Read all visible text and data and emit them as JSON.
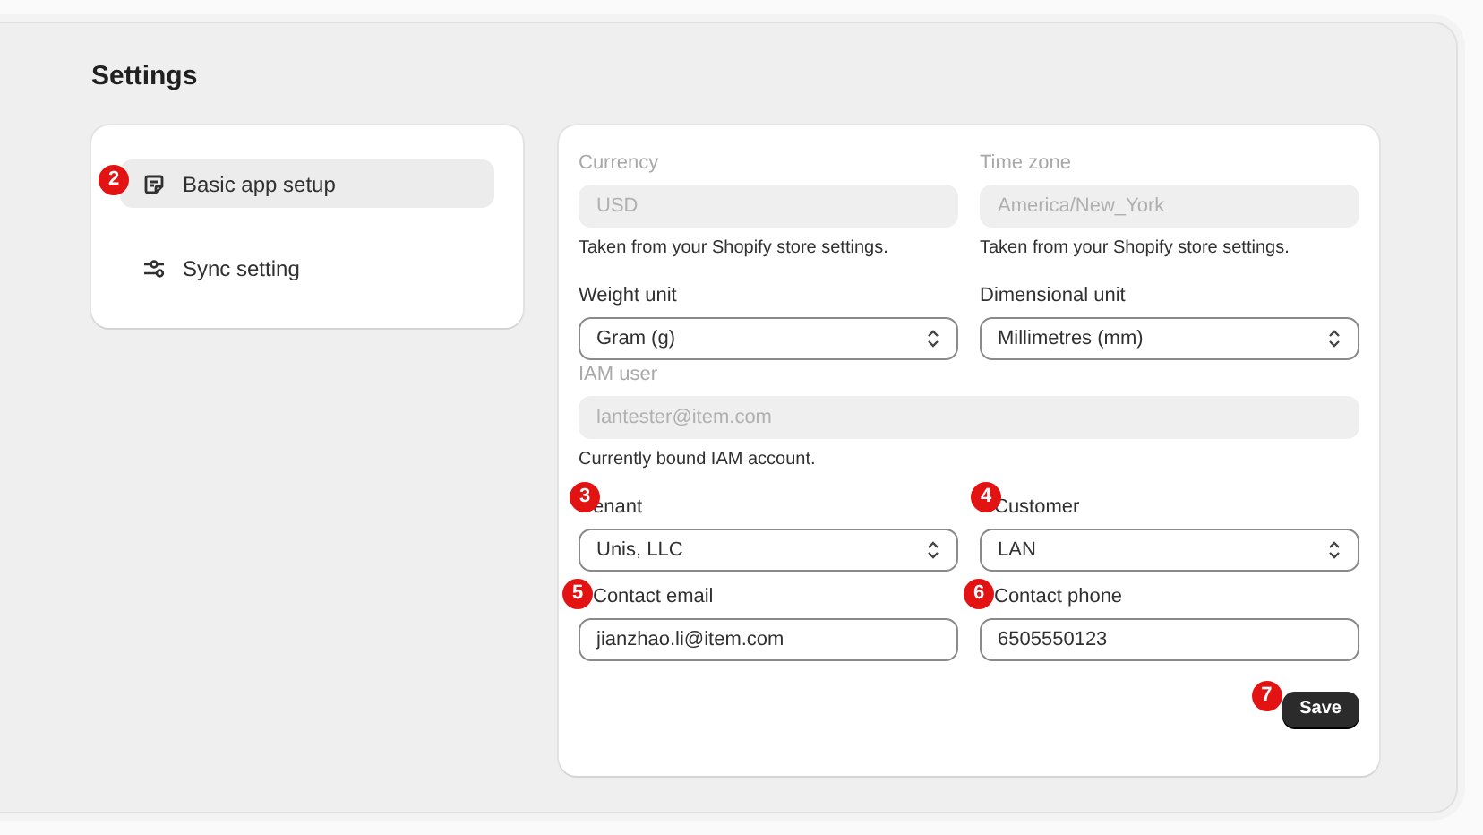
{
  "title": "Settings",
  "sidebar": {
    "items": [
      {
        "label": "Basic app setup",
        "selected": true,
        "badge": "2"
      },
      {
        "label": "Sync setting",
        "selected": false
      }
    ]
  },
  "form": {
    "rows": [
      {
        "fields": [
          {
            "kind": "text",
            "label": "Currency",
            "value": "USD",
            "disabled": true,
            "help": "Taken from your Shopify store settings."
          },
          {
            "kind": "text",
            "label": "Time zone",
            "value": "America/New_York",
            "disabled": true,
            "help": "Taken from your Shopify store settings."
          }
        ]
      },
      {
        "fields": [
          {
            "kind": "select",
            "label": "Weight unit",
            "value": "Gram (g)",
            "disabled": false
          },
          {
            "kind": "select",
            "label": "Dimensional unit",
            "value": "Millimetres (mm)",
            "disabled": false
          }
        ]
      },
      {
        "fields": [
          {
            "kind": "text",
            "label": "IAM user",
            "value": "lantester@item.com",
            "disabled": true,
            "help": "Currently bound IAM account."
          }
        ]
      },
      {
        "fields": [
          {
            "kind": "select",
            "label": "enant",
            "value": "Unis, LLC",
            "disabled": false,
            "badge": "3"
          },
          {
            "kind": "select",
            "label": "Customer",
            "value": "LAN",
            "disabled": false,
            "badge": "4"
          }
        ]
      },
      {
        "fields": [
          {
            "kind": "text",
            "label": "Contact email",
            "value": "jianzhao.li@item.com",
            "disabled": false,
            "badge": "5"
          },
          {
            "kind": "text",
            "label": "Contact phone",
            "value": "6505550123",
            "disabled": false,
            "badge": "6"
          }
        ]
      }
    ],
    "save": {
      "label": "Save",
      "badge": "7"
    }
  }
}
